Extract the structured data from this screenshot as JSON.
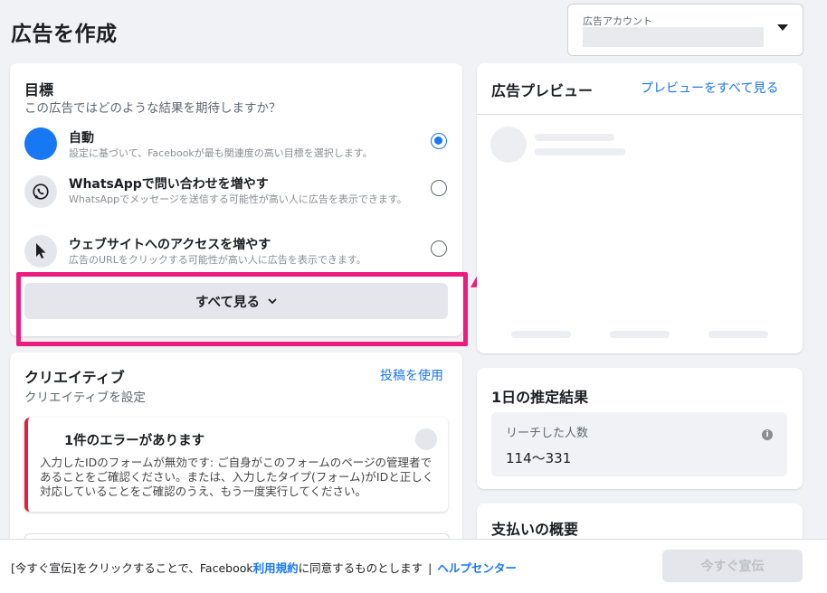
{
  "page": {
    "title": "広告を作成"
  },
  "account": {
    "label": "広告アカウント"
  },
  "objective": {
    "title": "目標",
    "subtitle": "この広告ではどのような結果を期待しますか？",
    "options": [
      {
        "title": "自動",
        "desc": "設定に基づいて、Facebookが最も関連度の高い目標を選択します。",
        "selected": true
      },
      {
        "title": "WhatsAppで問い合わせを増やす",
        "desc": "WhatsAppでメッセージを送信する可能性が高い人に広告を表示できます。",
        "selected": false
      },
      {
        "title": "ウェブサイトへのアクセスを増やす",
        "desc": "広告のURLをクリックする可能性が高い人に広告を表示できます。",
        "selected": false
      }
    ],
    "see_all": "すべて見る"
  },
  "creative": {
    "title": "クリエイティブ",
    "subtitle": "クリエイティブを設定",
    "use_post": "投稿を使用",
    "error_title": "1件のエラーがあります",
    "error_body": "入力したIDのフォームが無効です: ご自身がこのフォームのページの管理者であることをご確認ください。または、入力したタイプ(フォーム)がIDと正しく対応していることをご確認のうえ、もう一度実行してください。"
  },
  "preview": {
    "title": "広告プレビュー",
    "see_all": "プレビューをすべて見る"
  },
  "estimate": {
    "title": "1日の推定結果",
    "reach_label": "リーチした人数",
    "reach_value": "114〜331"
  },
  "payment": {
    "title": "支払いの概要"
  },
  "footer": {
    "text_prefix": "[今すぐ宣伝]をクリックすることで、Facebook",
    "terms": "利用規約",
    "text_suffix": "に同意するものとします",
    "separator": "|",
    "help": "ヘルプセンター",
    "cta": "今すぐ宣伝"
  },
  "colors": {
    "accent": "#1877f2",
    "highlight": "#ec1b7f",
    "error": "#e41e3f"
  }
}
